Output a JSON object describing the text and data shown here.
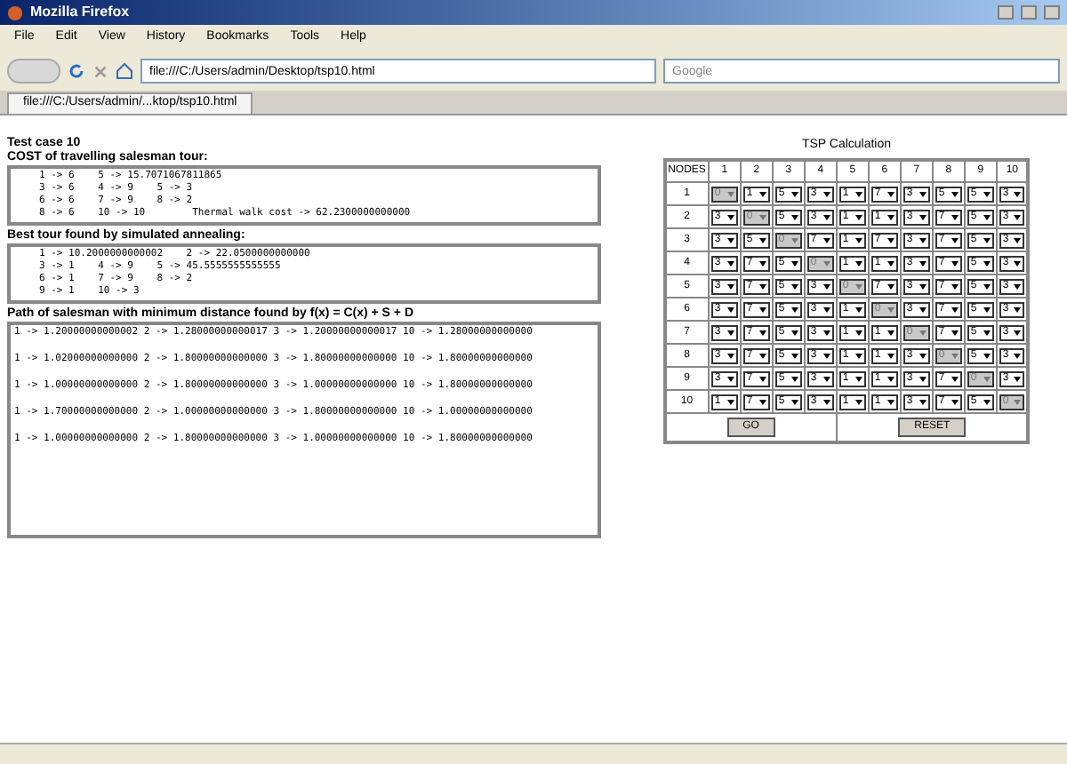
{
  "window": {
    "title": "Mozilla Firefox"
  },
  "menu": [
    "File",
    "Edit",
    "View",
    "History",
    "Bookmarks",
    "Tools",
    "Help"
  ],
  "address_bar": {
    "value": "file:///C:/Users/admin/Desktop/tsp10.html"
  },
  "search_field": {
    "placeholder": "Google"
  },
  "tabs": [
    {
      "label": "file:///C:/Users/admin/...ktop/tsp10.html",
      "selected": true
    }
  ],
  "left": {
    "test_case": "Test case 10",
    "section_1": {
      "heading": "COST of travelling salesman tour:",
      "lines": [
        "1 -> 6    5 -> 15.7071067811865",
        "3 -> 6    4 -> 9    5 -> 3",
        "6 -> 6    7 -> 9    8 -> 2",
        "8 -> 6    10 -> 10        Thermal walk cost -> 62.2300000000000"
      ]
    },
    "section_2": {
      "heading": "Best tour found by simulated annealing:",
      "lines": [
        "1 -> 10.2000000000002    2 -> 22.0500000000000",
        "3 -> 1    4 -> 9    5 -> 45.5555555555555",
        "6 -> 1    7 -> 9    8 -> 2",
        "9 -> 1    10 -> 3"
      ]
    },
    "section_3": {
      "heading": "Path of salesman with minimum distance found by f(x) = C(x) + S + D",
      "lines": [
        "1 -> 1.20000000000002 2 -> 1.28000000000017 3 -> 1.20000000000017 10 -> 1.28000000000000",
        "1 -> 1.02000000000000 2 -> 1.80000000000000 3 -> 1.80000000000000 10 -> 1.80000000000000",
        "1 -> 1.00000000000000 2 -> 1.80000000000000 3 -> 1.00000000000000 10 -> 1.80000000000000",
        "1 -> 1.70000000000000 2 -> 1.00000000000000 3 -> 1.80000000000000 10 -> 1.00000000000000",
        "1 -> 1.00000000000000 2 -> 1.80000000000000 3 -> 1.00000000000000 10 -> 1.80000000000000"
      ]
    }
  },
  "grid": {
    "title": "TSP Calculation",
    "corner": "NODES",
    "columns": [
      "1",
      "2",
      "3",
      "4",
      "5",
      "6",
      "7",
      "8",
      "9",
      "10"
    ],
    "rows": [
      {
        "node": "1",
        "cells": [
          {
            "value": "0",
            "disabled": true
          },
          {
            "value": "1",
            "disabled": false
          },
          {
            "value": "5",
            "disabled": false
          },
          {
            "value": "3",
            "disabled": false
          },
          {
            "value": "1",
            "disabled": false
          },
          {
            "value": "7",
            "disabled": false
          },
          {
            "value": "3",
            "disabled": false
          },
          {
            "value": "5",
            "disabled": false
          },
          {
            "value": "5",
            "disabled": false
          },
          {
            "value": "3",
            "disabled": false
          }
        ]
      },
      {
        "node": "2",
        "cells": [
          {
            "value": "3",
            "disabled": false
          },
          {
            "value": "0",
            "disabled": true
          },
          {
            "value": "5",
            "disabled": false
          },
          {
            "value": "3",
            "disabled": false
          },
          {
            "value": "1",
            "disabled": false
          },
          {
            "value": "1",
            "disabled": false
          },
          {
            "value": "3",
            "disabled": false
          },
          {
            "value": "7",
            "disabled": false
          },
          {
            "value": "5",
            "disabled": false
          },
          {
            "value": "3",
            "disabled": false
          }
        ]
      },
      {
        "node": "3",
        "cells": [
          {
            "value": "3",
            "disabled": false
          },
          {
            "value": "5",
            "disabled": false
          },
          {
            "value": "0",
            "disabled": true
          },
          {
            "value": "7",
            "disabled": false
          },
          {
            "value": "1",
            "disabled": false
          },
          {
            "value": "7",
            "disabled": false
          },
          {
            "value": "3",
            "disabled": false
          },
          {
            "value": "7",
            "disabled": false
          },
          {
            "value": "5",
            "disabled": false
          },
          {
            "value": "3",
            "disabled": false
          }
        ]
      },
      {
        "node": "4",
        "cells": [
          {
            "value": "3",
            "disabled": false
          },
          {
            "value": "7",
            "disabled": false
          },
          {
            "value": "5",
            "disabled": false
          },
          {
            "value": "0",
            "disabled": true
          },
          {
            "value": "1",
            "disabled": false
          },
          {
            "value": "1",
            "disabled": false
          },
          {
            "value": "3",
            "disabled": false
          },
          {
            "value": "7",
            "disabled": false
          },
          {
            "value": "5",
            "disabled": false
          },
          {
            "value": "3",
            "disabled": false
          }
        ]
      },
      {
        "node": "5",
        "cells": [
          {
            "value": "3",
            "disabled": false
          },
          {
            "value": "7",
            "disabled": false
          },
          {
            "value": "5",
            "disabled": false
          },
          {
            "value": "3",
            "disabled": false
          },
          {
            "value": "0",
            "disabled": true
          },
          {
            "value": "7",
            "disabled": false
          },
          {
            "value": "3",
            "disabled": false
          },
          {
            "value": "7",
            "disabled": false
          },
          {
            "value": "5",
            "disabled": false
          },
          {
            "value": "3",
            "disabled": false
          }
        ]
      },
      {
        "node": "6",
        "cells": [
          {
            "value": "3",
            "disabled": false
          },
          {
            "value": "7",
            "disabled": false
          },
          {
            "value": "5",
            "disabled": false
          },
          {
            "value": "3",
            "disabled": false
          },
          {
            "value": "1",
            "disabled": false
          },
          {
            "value": "0",
            "disabled": true
          },
          {
            "value": "3",
            "disabled": false
          },
          {
            "value": "7",
            "disabled": false
          },
          {
            "value": "5",
            "disabled": false
          },
          {
            "value": "3",
            "disabled": false
          }
        ]
      },
      {
        "node": "7",
        "cells": [
          {
            "value": "3",
            "disabled": false
          },
          {
            "value": "7",
            "disabled": false
          },
          {
            "value": "5",
            "disabled": false
          },
          {
            "value": "3",
            "disabled": false
          },
          {
            "value": "1",
            "disabled": false
          },
          {
            "value": "1",
            "disabled": false
          },
          {
            "value": "0",
            "disabled": true
          },
          {
            "value": "7",
            "disabled": false
          },
          {
            "value": "5",
            "disabled": false
          },
          {
            "value": "3",
            "disabled": false
          }
        ]
      },
      {
        "node": "8",
        "cells": [
          {
            "value": "3",
            "disabled": false
          },
          {
            "value": "7",
            "disabled": false
          },
          {
            "value": "5",
            "disabled": false
          },
          {
            "value": "3",
            "disabled": false
          },
          {
            "value": "1",
            "disabled": false
          },
          {
            "value": "1",
            "disabled": false
          },
          {
            "value": "3",
            "disabled": false
          },
          {
            "value": "0",
            "disabled": true
          },
          {
            "value": "5",
            "disabled": false
          },
          {
            "value": "3",
            "disabled": false
          }
        ]
      },
      {
        "node": "9",
        "cells": [
          {
            "value": "3",
            "disabled": false
          },
          {
            "value": "7",
            "disabled": false
          },
          {
            "value": "5",
            "disabled": false
          },
          {
            "value": "3",
            "disabled": false
          },
          {
            "value": "1",
            "disabled": false
          },
          {
            "value": "1",
            "disabled": false
          },
          {
            "value": "3",
            "disabled": false
          },
          {
            "value": "7",
            "disabled": false
          },
          {
            "value": "0",
            "disabled": true
          },
          {
            "value": "3",
            "disabled": false
          }
        ]
      },
      {
        "node": "10",
        "cells": [
          {
            "value": "1",
            "disabled": false
          },
          {
            "value": "7",
            "disabled": false
          },
          {
            "value": "5",
            "disabled": false
          },
          {
            "value": "3",
            "disabled": false
          },
          {
            "value": "1",
            "disabled": false
          },
          {
            "value": "1",
            "disabled": false
          },
          {
            "value": "3",
            "disabled": false
          },
          {
            "value": "7",
            "disabled": false
          },
          {
            "value": "5",
            "disabled": false
          },
          {
            "value": "0",
            "disabled": true
          }
        ]
      }
    ],
    "buttons": [
      "GO",
      "RESET"
    ]
  }
}
